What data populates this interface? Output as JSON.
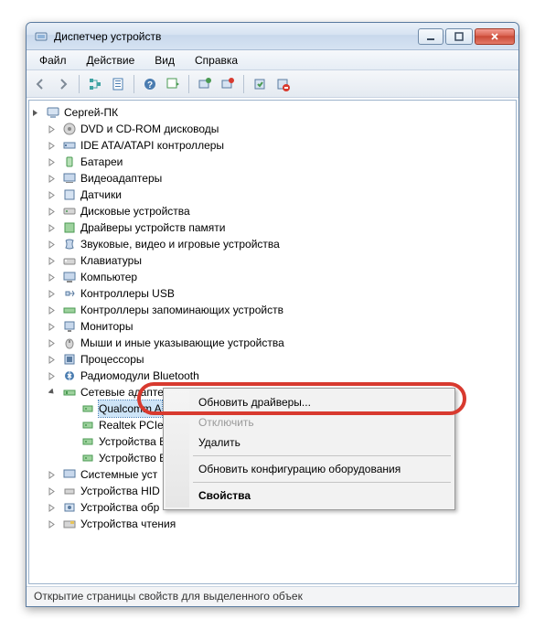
{
  "title": "Диспетчер устройств",
  "menubar": [
    "Файл",
    "Действие",
    "Вид",
    "Справка"
  ],
  "root": "Сергей-ПК",
  "categories": [
    "DVD и CD-ROM дисководы",
    "IDE ATA/ATAPI контроллеры",
    "Батареи",
    "Видеоадаптеры",
    "Датчики",
    "Дисковые устройства",
    "Драйверы устройств памяти",
    "Звуковые, видео и игровые устройства",
    "Клавиатуры",
    "Компьютер",
    "Контроллеры USB",
    "Контроллеры запоминающих устройств",
    "Мониторы",
    "Мыши и иные указывающие устройства",
    "Процессоры",
    "Радиомодули Bluetooth",
    "Сетевые адаптеры"
  ],
  "network_children": [
    "Qualcomm A",
    "Realtek PCIe",
    "Устройства E",
    "Устройство E"
  ],
  "categories_after": [
    "Системные уст",
    "Устройства HID",
    "Устройства обр",
    "Устройства чтения"
  ],
  "context_menu": {
    "update": "Обновить драйверы...",
    "disable": "Отключить",
    "delete": "Удалить",
    "scan": "Обновить конфигурацию оборудования",
    "properties": "Свойства"
  },
  "status": "Открытие страницы свойств для выделенного объек"
}
